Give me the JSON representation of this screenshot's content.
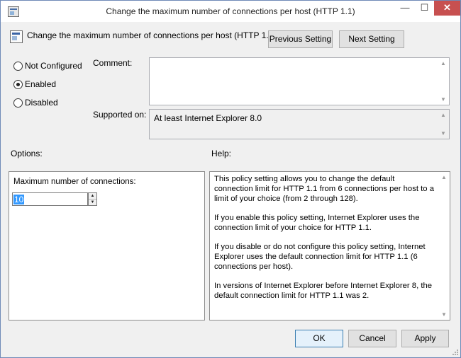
{
  "window": {
    "title": "Change the maximum number of connections per host (HTTP 1.1)",
    "minimize_glyph": "—",
    "maximize_glyph": "☐",
    "close_glyph": "✕"
  },
  "header": {
    "title": "Change the maximum number of connections per host (HTTP 1.1)",
    "prev_label": "Previous Setting",
    "next_label": "Next Setting"
  },
  "state": {
    "options": [
      {
        "label": "Not Configured",
        "selected": false
      },
      {
        "label": "Enabled",
        "selected": true
      },
      {
        "label": "Disabled",
        "selected": false
      }
    ]
  },
  "comment": {
    "label": "Comment:",
    "value": ""
  },
  "supported": {
    "label": "Supported on:",
    "value": "At least Internet Explorer 8.0"
  },
  "options_panel": {
    "heading": "Options:",
    "field_label": "Maximum number of connections:",
    "field_value": "10"
  },
  "help_panel": {
    "heading": "Help:",
    "paragraphs": [
      "This policy setting allows you to change the default connection limit for HTTP 1.1 from 6 connections per host to a limit of your choice (from 2 through 128).",
      "If you enable this policy setting, Internet Explorer uses the connection limit of your choice for HTTP 1.1.",
      "If you disable or do not configure this policy setting, Internet Explorer uses the default connection limit for HTTP 1.1 (6 connections per host).",
      "In versions of Internet Explorer before Internet Explorer 8, the default connection limit for HTTP 1.1 was 2."
    ]
  },
  "footer": {
    "ok_label": "OK",
    "cancel_label": "Cancel",
    "apply_label": "Apply"
  },
  "icons": {
    "scroll_up": "▲",
    "scroll_down": "▼"
  },
  "colors": {
    "selection": "#3399ff",
    "close_button": "#c75050",
    "default_button_border": "#3c7fb1"
  }
}
